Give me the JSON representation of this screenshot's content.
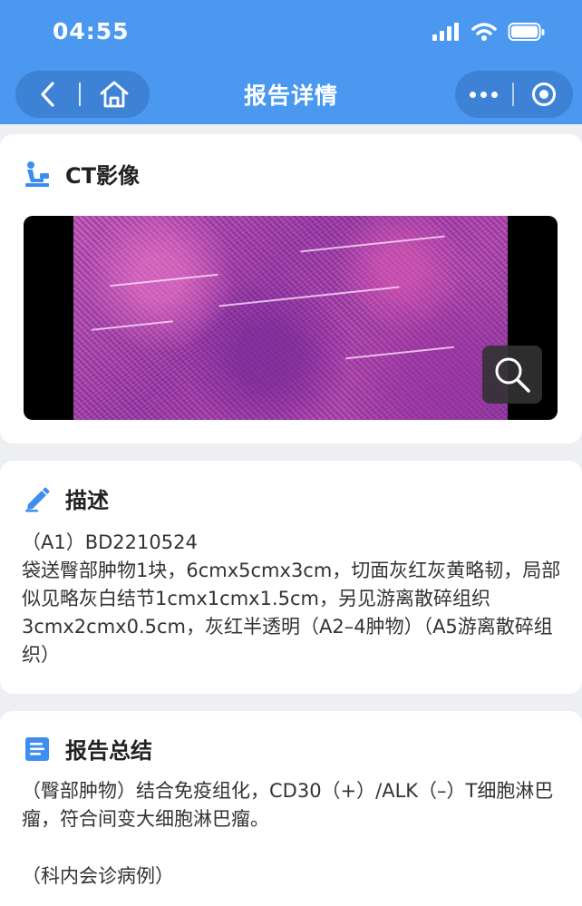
{
  "status_bar": {
    "time": "04:55"
  },
  "nav": {
    "title": "报告详情"
  },
  "image_section": {
    "title": "CT影像"
  },
  "description": {
    "title": "描述",
    "specimen_id": "（A1）BD2210524",
    "text": "袋送臀部肿物1块，6cmx5cmx3cm，切面灰红灰黄略韧，局部似见略灰白结节1cmx1cmx1.5cm，另见游离散碎组织3cmx2cmx0.5cm，灰红半透明（A2–4肿物）（A5游离散碎组织）"
  },
  "summary": {
    "title": "报告总结",
    "text": "（臀部肿物）结合免疫组化，CD30（+）/ALK（–）T细胞淋巴瘤，符合间变大细胞淋巴瘤。",
    "note": "（科内会诊病例）"
  },
  "colors": {
    "header_bg": "#4a98ef",
    "accent_blue": "#3d8ef0",
    "page_bg": "#eeeff3"
  },
  "icons": [
    "signal-icon",
    "wifi-icon",
    "battery-icon",
    "back-arrow-icon",
    "home-icon",
    "more-dots-icon",
    "target-icon",
    "patient-scan-icon",
    "pencil-icon",
    "document-list-icon",
    "zoom-search-icon"
  ]
}
